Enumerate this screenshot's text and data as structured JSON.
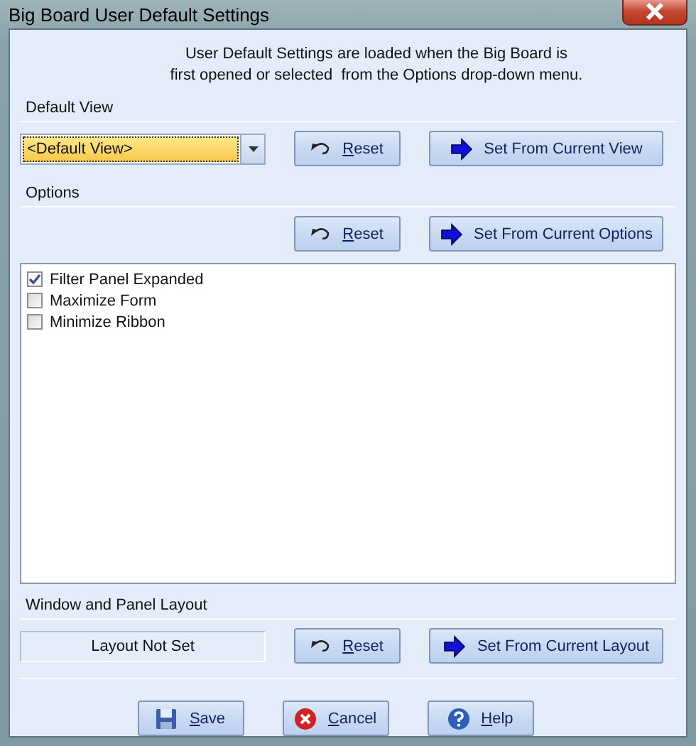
{
  "window": {
    "title": "Big Board User Default Settings"
  },
  "intro": [
    "User Default Settings are loaded when the Big Board is",
    "first opened or selected  from the Options drop-down menu."
  ],
  "default_view": {
    "label": "Default View",
    "combo": {
      "value": "<Default View>"
    },
    "buttons": [
      {
        "kind": "reset",
        "label": "Reset"
      },
      {
        "kind": "set",
        "label": "Set From Current View"
      }
    ]
  },
  "options": {
    "label": "Options",
    "buttons": [
      {
        "kind": "reset",
        "label": "Reset"
      },
      {
        "kind": "set",
        "label": "Set From Current Options"
      }
    ],
    "items": [
      {
        "label": "Filter Panel Expanded",
        "checked": true
      },
      {
        "label": "Maximize Form",
        "checked": false
      },
      {
        "label": "Minimize Ribbon",
        "checked": false
      }
    ]
  },
  "layout": {
    "label": "Window and Panel Layout",
    "status": "Layout Not Set",
    "buttons": [
      {
        "kind": "reset",
        "label": "Reset"
      },
      {
        "kind": "set",
        "label": "Set From Current Layout"
      }
    ]
  },
  "footer": [
    {
      "kind": "save",
      "label": "Save"
    },
    {
      "kind": "cancel",
      "label": "Cancel"
    },
    {
      "kind": "help",
      "label": "Help"
    }
  ]
}
